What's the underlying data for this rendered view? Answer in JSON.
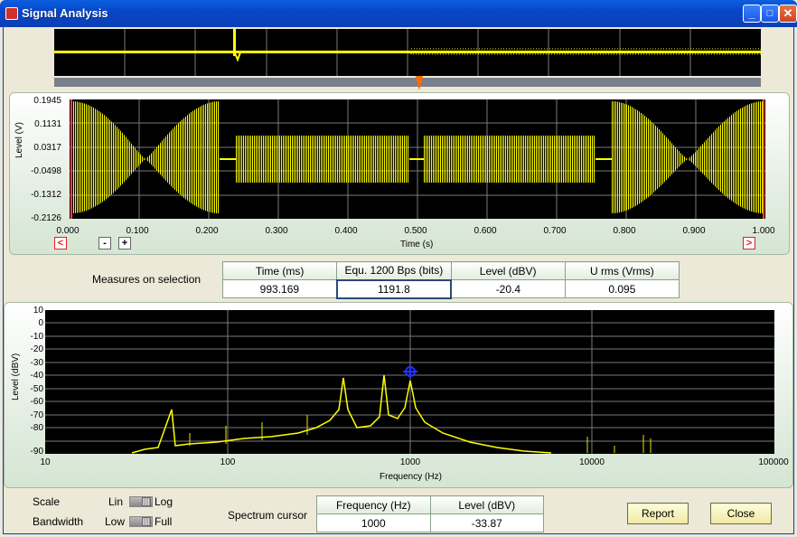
{
  "window": {
    "title": "Signal Analysis",
    "minimize": "_",
    "maximize": "□",
    "close": "✕"
  },
  "icons": {
    "app": "app-icon",
    "cursor": "crosshair-cursor-icon"
  },
  "colors": {
    "trace": "#ffff00",
    "plot_bg": "#000000",
    "grid": "#7a7a7a",
    "cursor": "#2233ff",
    "selection": "#ff4040"
  },
  "time_plot": {
    "ylabel": "Level (V)",
    "xlabel": "Time (s)",
    "yticks": [
      "0.1945",
      "0.1131",
      "0.0317",
      "-0.0498",
      "-0.1312",
      "-0.2126"
    ],
    "xticks": [
      "0.000",
      "0.100",
      "0.200",
      "0.300",
      "0.400",
      "0.500",
      "0.600",
      "0.700",
      "0.800",
      "0.900",
      "1.000"
    ],
    "nav": {
      "left": "<",
      "minus": "-",
      "plus": "+",
      "right": ">"
    }
  },
  "measures": {
    "label": "Measures on selection",
    "headers": [
      "Time (ms)",
      "Equ. 1200 Bps (bits)",
      "Level (dBV)",
      "U rms (Vrms)"
    ],
    "values": [
      "993.169",
      "1191.8",
      "-20.4",
      "0.095"
    ]
  },
  "spectrum_plot": {
    "ylabel": "Level (dBV)",
    "xlabel": "Frequency (Hz)",
    "yticks": [
      "10",
      "0",
      "-10",
      "-20",
      "-30",
      "-40",
      "-50",
      "-60",
      "-70",
      "-80",
      "-90"
    ],
    "xticks": [
      "10",
      "100",
      "1000",
      "10000",
      "100000"
    ],
    "cursor": {
      "frequency_hz": 1000,
      "level_dbv": -33.87
    }
  },
  "controls": {
    "scale": {
      "label": "Scale",
      "left": "Lin",
      "right": "Log",
      "state": "Log"
    },
    "bandwidth": {
      "label": "Bandwidth",
      "left": "Low",
      "right": "Full",
      "state": "Full"
    },
    "spectrum_cursor": {
      "label": "Spectrum cursor",
      "headers": [
        "Frequency (Hz)",
        "Level (dBV)"
      ],
      "values": [
        "1000",
        "-33.87"
      ]
    },
    "report_button": "Report",
    "close_button": "Close"
  }
}
